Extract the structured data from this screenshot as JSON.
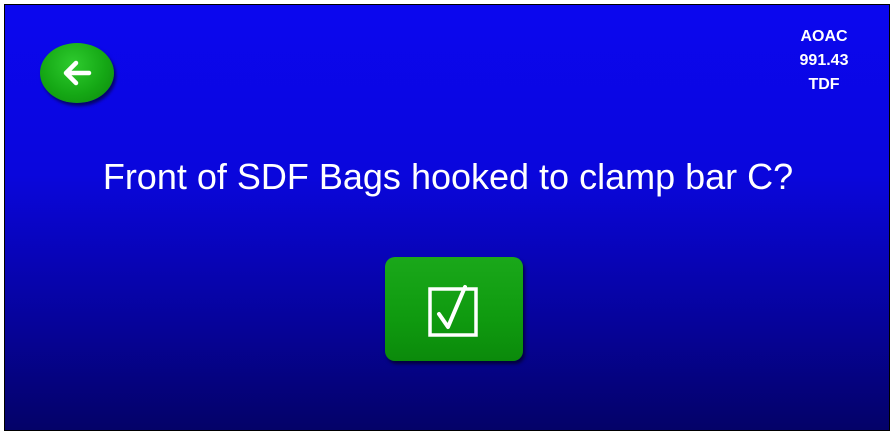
{
  "header": {
    "back_icon": "arrow-left-icon",
    "method_label": [
      "AOAC",
      "991.43",
      "TDF"
    ]
  },
  "main": {
    "question": "Front of SDF Bags hooked to clamp bar C?",
    "confirm_icon": "checkbox-checked-icon"
  },
  "colors": {
    "background_top": "#0b07ef",
    "background_bottom": "#040268",
    "button_green": "#15a815",
    "text": "#ffffff"
  }
}
